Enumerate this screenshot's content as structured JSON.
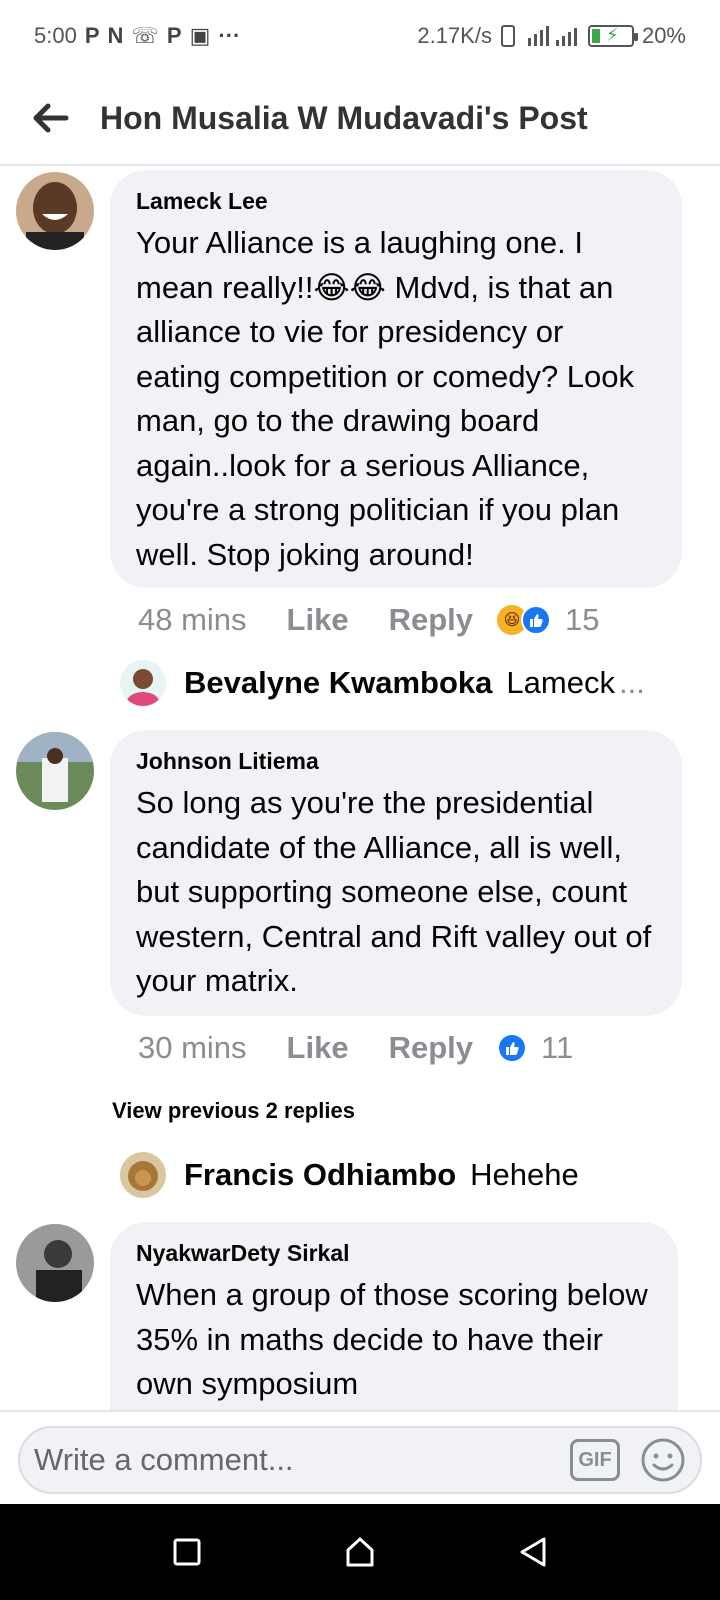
{
  "status_bar": {
    "time": "5:00",
    "app_icons": [
      "P",
      "N",
      "☏",
      "P",
      "▣",
      "···"
    ],
    "net_speed": "2.17K/s",
    "battery": "20%",
    "battery_level": 0.2
  },
  "header": {
    "title": "Hon Musalia W Mudavadi's Post"
  },
  "comments": [
    {
      "author": "Lameck Lee",
      "text": "Your Alliance is a laughing one.  I mean really!!😂😂 Mdvd, is that an alliance to vie for presidency or eating competition or comedy? Look man,  go to the drawing board again..look for a serious Alliance, you're a strong politician if you plan well. Stop joking around!",
      "time": "48 mins",
      "like_label": "Like",
      "reply_label": "Reply",
      "reactions": [
        "haha",
        "like"
      ],
      "reaction_count": "15",
      "reply_preview": {
        "name": "Bevalyne Kwamboka",
        "text": "Lameck",
        "ellipsis": "..."
      }
    },
    {
      "author": "Johnson Litiema",
      "text": "So long as you're the presidential candidate of the Alliance, all is well, but supporting someone else, count western, Central and Rift valley out of your matrix.",
      "time": "30 mins",
      "like_label": "Like",
      "reply_label": "Reply",
      "reactions": [
        "like"
      ],
      "reaction_count": "11",
      "view_previous": "View previous 2 replies",
      "reply_preview": {
        "name": "Francis Odhiambo",
        "text": "Hehehe"
      }
    },
    {
      "author": "NyakwarDety Sirkal",
      "text": "When a group of those scoring below 35% in maths decide to have their own symposium"
    }
  ],
  "composer": {
    "placeholder": "Write a comment...",
    "gif_label": "GIF"
  },
  "colors": {
    "bubble": "#f0f2f5",
    "meta_text": "#8a8d91",
    "like_blue": "#1877f2",
    "haha_yellow": "#f7b125"
  }
}
